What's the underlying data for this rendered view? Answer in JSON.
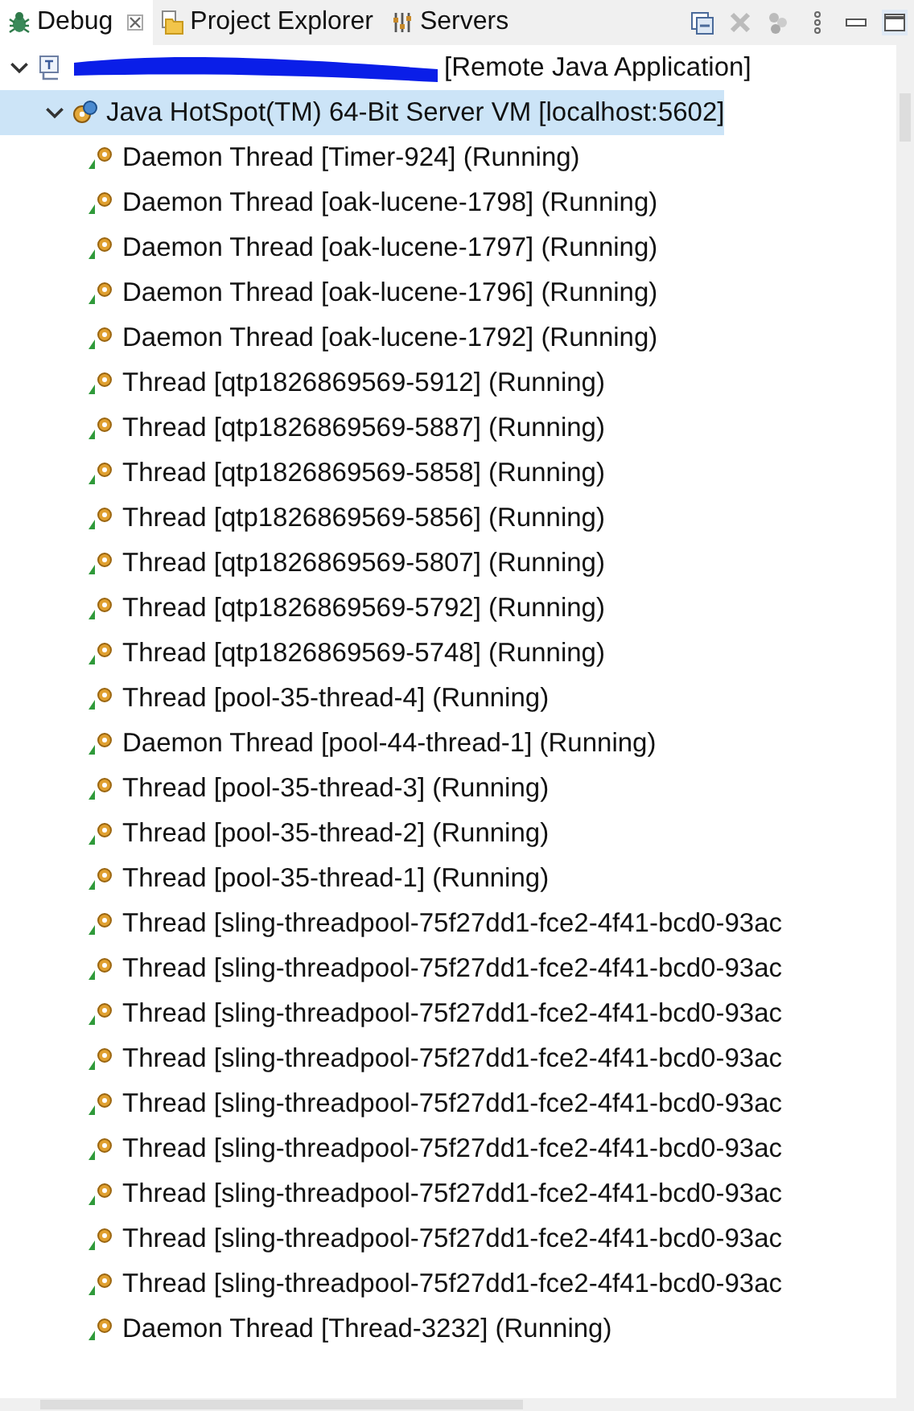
{
  "tabs": [
    {
      "label": "Debug",
      "selected": true,
      "closable": true,
      "kind": "bug"
    },
    {
      "label": "Project Explorer",
      "selected": false,
      "closable": false,
      "kind": "folder"
    },
    {
      "label": "Servers",
      "selected": false,
      "closable": false,
      "kind": "servers"
    }
  ],
  "tree": [
    {
      "kind": "launch",
      "label": "[Remote Java Application]",
      "redacted": true,
      "expanded": true,
      "selected": false,
      "children": [
        {
          "kind": "vm",
          "label": "Java HotSpot(TM) 64-Bit Server VM [localhost:5602]",
          "expanded": true,
          "selected": true,
          "children": [
            {
              "kind": "thread",
              "label": "Daemon Thread [Timer-924] (Running)",
              "selected": false
            },
            {
              "kind": "thread",
              "label": "Daemon Thread [oak-lucene-1798] (Running)",
              "selected": false
            },
            {
              "kind": "thread",
              "label": "Daemon Thread [oak-lucene-1797] (Running)",
              "selected": false
            },
            {
              "kind": "thread",
              "label": "Daemon Thread [oak-lucene-1796] (Running)",
              "selected": false
            },
            {
              "kind": "thread",
              "label": "Daemon Thread [oak-lucene-1792] (Running)",
              "selected": false
            },
            {
              "kind": "thread",
              "label": "Thread [qtp1826869569-5912] (Running)",
              "selected": false
            },
            {
              "kind": "thread",
              "label": "Thread [qtp1826869569-5887] (Running)",
              "selected": false
            },
            {
              "kind": "thread",
              "label": "Thread [qtp1826869569-5858] (Running)",
              "selected": false
            },
            {
              "kind": "thread",
              "label": "Thread [qtp1826869569-5856] (Running)",
              "selected": false
            },
            {
              "kind": "thread",
              "label": "Thread [qtp1826869569-5807] (Running)",
              "selected": false
            },
            {
              "kind": "thread",
              "label": "Thread [qtp1826869569-5792] (Running)",
              "selected": false
            },
            {
              "kind": "thread",
              "label": "Thread [qtp1826869569-5748] (Running)",
              "selected": false
            },
            {
              "kind": "thread",
              "label": "Thread [pool-35-thread-4] (Running)",
              "selected": false
            },
            {
              "kind": "thread",
              "label": "Daemon Thread [pool-44-thread-1] (Running)",
              "selected": false
            },
            {
              "kind": "thread",
              "label": "Thread [pool-35-thread-3] (Running)",
              "selected": false
            },
            {
              "kind": "thread",
              "label": "Thread [pool-35-thread-2] (Running)",
              "selected": false
            },
            {
              "kind": "thread",
              "label": "Thread [pool-35-thread-1] (Running)",
              "selected": false
            },
            {
              "kind": "thread",
              "label": "Thread [sling-threadpool-75f27dd1-fce2-4f41-bcd0-93ac",
              "selected": false
            },
            {
              "kind": "thread",
              "label": "Thread [sling-threadpool-75f27dd1-fce2-4f41-bcd0-93ac",
              "selected": false
            },
            {
              "kind": "thread",
              "label": "Thread [sling-threadpool-75f27dd1-fce2-4f41-bcd0-93ac",
              "selected": false
            },
            {
              "kind": "thread",
              "label": "Thread [sling-threadpool-75f27dd1-fce2-4f41-bcd0-93ac",
              "selected": false
            },
            {
              "kind": "thread",
              "label": "Thread [sling-threadpool-75f27dd1-fce2-4f41-bcd0-93ac",
              "selected": false
            },
            {
              "kind": "thread",
              "label": "Thread [sling-threadpool-75f27dd1-fce2-4f41-bcd0-93ac",
              "selected": false
            },
            {
              "kind": "thread",
              "label": "Thread [sling-threadpool-75f27dd1-fce2-4f41-bcd0-93ac",
              "selected": false
            },
            {
              "kind": "thread",
              "label": "Thread [sling-threadpool-75f27dd1-fce2-4f41-bcd0-93ac",
              "selected": false
            },
            {
              "kind": "thread",
              "label": "Thread [sling-threadpool-75f27dd1-fce2-4f41-bcd0-93ac",
              "selected": false
            },
            {
              "kind": "thread",
              "label": "Daemon Thread [Thread-3232] (Running)",
              "selected": false
            }
          ]
        }
      ]
    }
  ]
}
